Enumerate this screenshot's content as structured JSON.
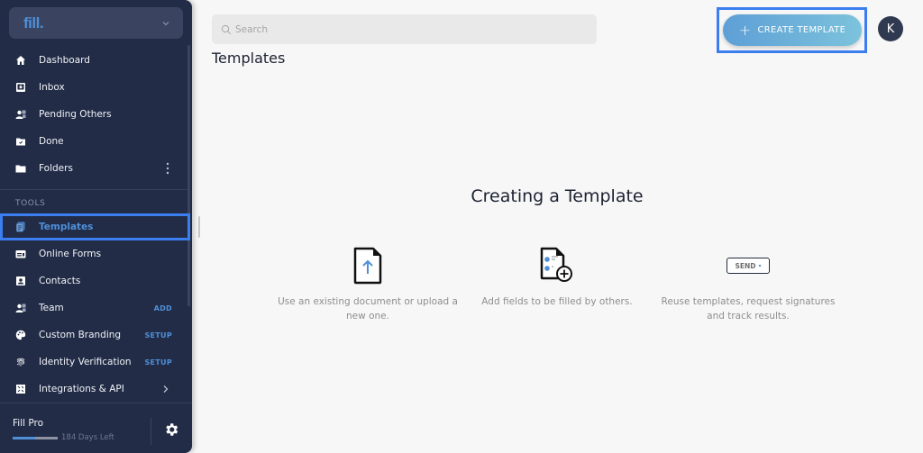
{
  "brand": {
    "logo_text": "fill.",
    "switcher_icon": "chevron-down-icon"
  },
  "sidebar": {
    "primary_items": [
      {
        "label": "Dashboard",
        "icon": "home-icon"
      },
      {
        "label": "Inbox",
        "icon": "inbox-icon"
      },
      {
        "label": "Pending Others",
        "icon": "users-pending-icon"
      },
      {
        "label": "Done",
        "icon": "folder-check-icon"
      },
      {
        "label": "Folders",
        "icon": "folder-icon",
        "action_icon": "more-vertical-icon"
      }
    ],
    "section_label": "TOOLS",
    "tool_items": [
      {
        "label": "Templates",
        "icon": "templates-icon",
        "active": true
      },
      {
        "label": "Online Forms",
        "icon": "form-icon"
      },
      {
        "label": "Contacts",
        "icon": "contact-icon"
      },
      {
        "label": "Team",
        "icon": "team-icon",
        "tag": "ADD"
      },
      {
        "label": "Custom Branding",
        "icon": "palette-icon",
        "tag": "SETUP"
      },
      {
        "label": "Identity Verification",
        "icon": "fingerprint-icon",
        "tag": "SETUP"
      },
      {
        "label": "Integrations & API",
        "icon": "puzzle-icon",
        "action_icon": "chevron-right-icon"
      }
    ],
    "footer": {
      "plan_name": "Fill Pro",
      "days_left_label": "184 Days Left",
      "plan_progress_percent": 50,
      "settings_icon": "gear-icon"
    }
  },
  "header": {
    "search_placeholder": "Search",
    "search_value": "",
    "create_button_label": "CREATE TEMPLATE",
    "avatar_initial": "K"
  },
  "page": {
    "title": "Templates"
  },
  "empty_state": {
    "title": "Creating a Template",
    "steps": [
      {
        "icon": "upload-document-icon",
        "description": "Use an existing document or upload a new one."
      },
      {
        "icon": "add-fields-icon",
        "description": "Add fields to be filled by others."
      },
      {
        "icon": "send-button-icon",
        "icon_label": "SEND",
        "description": "Reuse templates, request signatures and track results."
      }
    ]
  },
  "colors": {
    "sidebar_bg": "#222c47",
    "accent": "#4f8fd8",
    "highlight_outline": "#3b7ef0",
    "main_bg": "#f7f7f7"
  }
}
